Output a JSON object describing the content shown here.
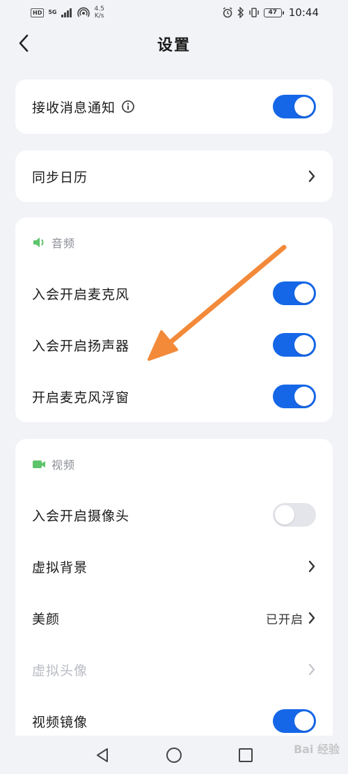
{
  "status_bar": {
    "hd": "HD",
    "net_type": "5G",
    "net_speed_value": "4.5",
    "net_speed_unit": "K/s",
    "battery": "47",
    "time": "10:44"
  },
  "header": {
    "title": "设置"
  },
  "notifications": {
    "label": "接收消息通知",
    "toggle_on": true
  },
  "calendar": {
    "label": "同步日历"
  },
  "audio": {
    "section_title": "音频",
    "items": [
      {
        "label": "入会开启麦克风",
        "toggle_on": true
      },
      {
        "label": "入会开启扬声器",
        "toggle_on": true
      },
      {
        "label": "开启麦克风浮窗",
        "toggle_on": true
      }
    ]
  },
  "video": {
    "section_title": "视频",
    "camera": {
      "label": "入会开启摄像头",
      "toggle_on": false
    },
    "virtual_bg": {
      "label": "虚拟背景"
    },
    "beauty": {
      "label": "美颜",
      "value": "已开启"
    },
    "virtual_avatar": {
      "label": "虚拟头像",
      "disabled": true
    },
    "mirror": {
      "label": "视频镜像",
      "toggle_on": true
    }
  },
  "watermark": "Bai 经验",
  "colors": {
    "accent": "#1667e8",
    "section_icon": "#5cc46a",
    "annotation_arrow": "#f28a3a",
    "background": "#f2f3f7"
  }
}
